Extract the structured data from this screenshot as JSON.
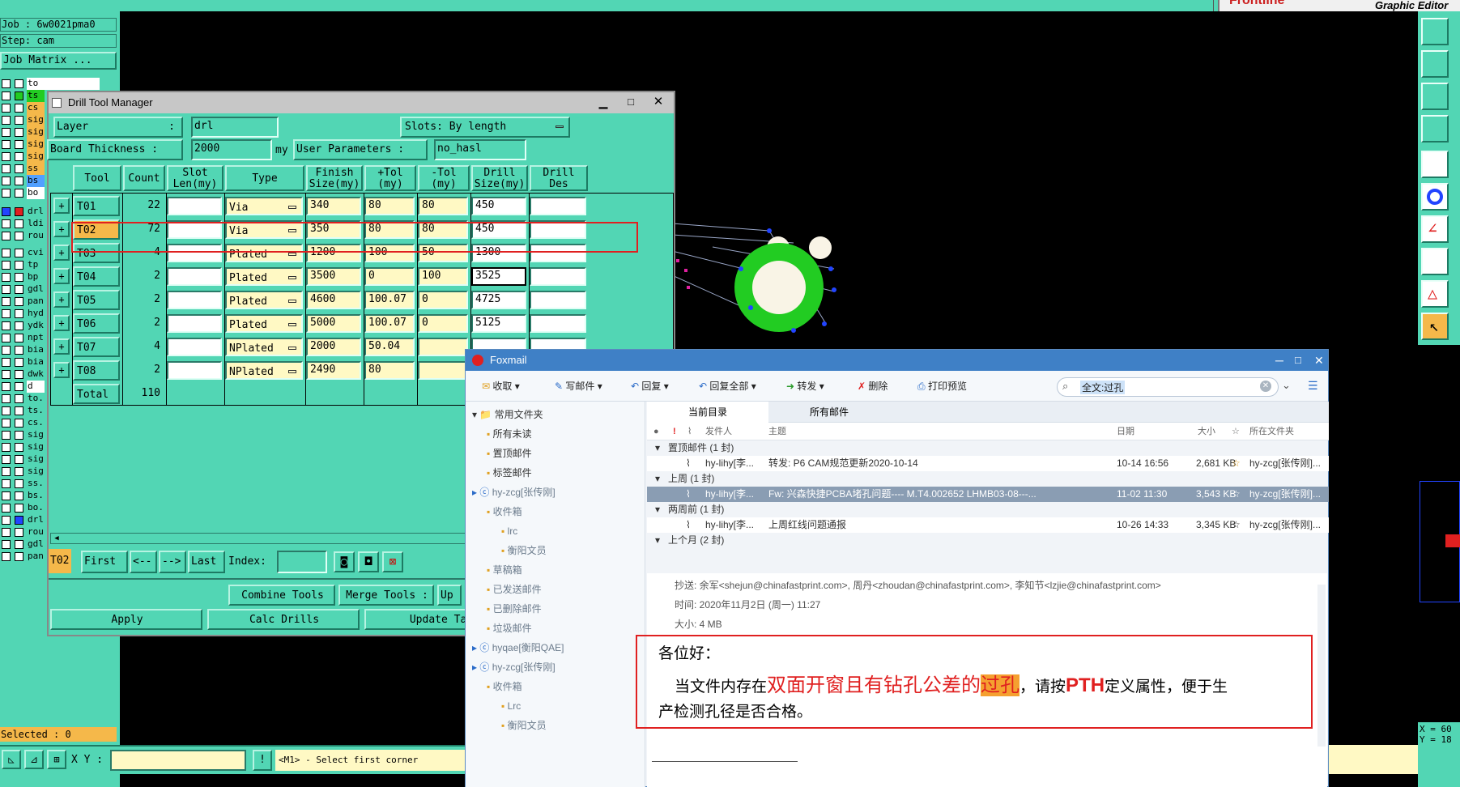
{
  "top": {
    "header_label": "Graphic Editor",
    "logo_label": "Frontline"
  },
  "left_panel": {
    "job_line": "Job : 6w0021pma0",
    "step_line": "Step: cam",
    "job_matrix_label": "Job Matrix ...",
    "layers": [
      "to",
      "ts",
      "cs",
      "sig",
      "sig",
      "sig",
      "sig",
      "ss",
      "bs",
      "bo",
      "drl",
      "ldi",
      "rou",
      "cvi",
      "tp",
      "bp",
      "gdl",
      "pan",
      "hyd",
      "ydk",
      "npt",
      "bia",
      "bia",
      "dwk",
      "d",
      "to.",
      "ts.",
      "cs.",
      "sig",
      "sig",
      "sig",
      "sig",
      "ss.",
      "bs.",
      "bo.",
      "drl",
      "rou",
      "gdl",
      "pan"
    ],
    "selected_label": "Selected : 0"
  },
  "dtm": {
    "title": "Drill Tool Manager",
    "layer_label": "Layer",
    "layer_value": "drl",
    "slots_label": "Slots:",
    "slots_value": "By length",
    "board_thickness_label": "Board Thickness :",
    "board_thickness_value": "2000",
    "board_thickness_unit": "my",
    "user_params_label": "User Parameters :",
    "user_params_value": "no_hasl",
    "headers": {
      "tool": "Tool",
      "count": "Count",
      "slot_len": "Slot Len(my)",
      "type": "Type",
      "finish": "Finish Size(my)",
      "ptol": "+Tol (my)",
      "mtol": "-Tol (my)",
      "drill": "Drill Size(my)",
      "drill_des": "Drill Des"
    },
    "rows": [
      {
        "tool": "T01",
        "count": "22",
        "type": "Via",
        "finish": "340",
        "ptol": "80",
        "mtol": "80",
        "drill": "450"
      },
      {
        "tool": "T02",
        "count": "72",
        "type": "Via",
        "finish": "350",
        "ptol": "80",
        "mtol": "80",
        "drill": "450"
      },
      {
        "tool": "T03",
        "count": "4",
        "type": "Plated",
        "finish": "1200",
        "ptol": "100",
        "mtol": "50",
        "drill": "1300"
      },
      {
        "tool": "T04",
        "count": "2",
        "type": "Plated",
        "finish": "3500",
        "ptol": "0",
        "mtol": "100",
        "drill": "3525"
      },
      {
        "tool": "T05",
        "count": "2",
        "type": "Plated",
        "finish": "4600",
        "ptol": "100.07",
        "mtol": "0",
        "drill": "4725"
      },
      {
        "tool": "T06",
        "count": "2",
        "type": "Plated",
        "finish": "5000",
        "ptol": "100.07",
        "mtol": "0",
        "drill": "5125"
      },
      {
        "tool": "T07",
        "count": "4",
        "type": "NPlated",
        "finish": "2000",
        "ptol": "50.04",
        "mtol": "",
        "drill": ""
      },
      {
        "tool": "T08",
        "count": "2",
        "type": "NPlated",
        "finish": "2490",
        "ptol": "80",
        "mtol": "",
        "drill": ""
      }
    ],
    "total_label": "Total",
    "total_value": "110",
    "nav": {
      "current_tool": "T02",
      "first": "First",
      "prev": "<--",
      "next": "-->",
      "last": "Last",
      "index": "Index:"
    },
    "combine_tools": "Combine Tools",
    "merge_tools": "Merge Tools :",
    "up_label": "Up",
    "apply": "Apply",
    "calc_drills": "Calc Drills",
    "update_tab": "Update Tab"
  },
  "statusbar": {
    "xy_label": "X Y :",
    "hint": "<M1> - Select first corner",
    "coord_x": "X = 60",
    "coord_y": "Y = 18"
  },
  "foxmail": {
    "title": "Foxmail",
    "toolbar": [
      "收取",
      "写邮件",
      "回复",
      "回复全部",
      "转发",
      "删除",
      "打印预览"
    ],
    "search_value": "全文:过孔",
    "folder_tabs": [
      "当前目录",
      "所有邮件"
    ],
    "folders": [
      {
        "label": "常用文件夹",
        "level": 0
      },
      {
        "label": "所有未读",
        "level": 1
      },
      {
        "label": "置顶邮件",
        "level": 1
      },
      {
        "label": "标签邮件",
        "level": 1
      },
      {
        "label": "hy-zcg[张传刚]",
        "level": 0
      },
      {
        "label": "收件箱",
        "level": 1
      },
      {
        "label": "lrc",
        "level": 2
      },
      {
        "label": "衡阳文员",
        "level": 2
      },
      {
        "label": "草稿箱",
        "level": 1
      },
      {
        "label": "已发送邮件",
        "level": 1
      },
      {
        "label": "已删除邮件",
        "level": 1
      },
      {
        "label": "垃圾邮件",
        "level": 1
      },
      {
        "label": "hyqae[衡阳QAE]",
        "level": 0
      },
      {
        "label": "hy-zcg[张传刚]",
        "level": 0
      },
      {
        "label": "收件箱",
        "level": 1
      },
      {
        "label": "Lrc",
        "level": 2
      },
      {
        "label": "衡阳文员",
        "level": 2
      }
    ],
    "columns": {
      "sender": "发件人",
      "subject": "主题",
      "date": "日期",
      "size": "大小",
      "folder": "所在文件夹"
    },
    "groups": [
      {
        "label": "置顶邮件 (1 封)"
      },
      {
        "label": "上周 (1 封)"
      },
      {
        "label": "两周前 (1 封)"
      },
      {
        "label": "上个月 (2 封)"
      }
    ],
    "mails": [
      {
        "sender": "hy-lihy[李...",
        "subject": "转发: P6 CAM规范更新2020-10-14",
        "date": "10-14 16:56",
        "size": "2,681 KB",
        "folder": "hy-zcg[张传刚]..."
      },
      {
        "sender": "hy-lihy[李...",
        "subject": "Fw: 兴森快捷PCBA堵孔问题----  M.T4.002652 LHMB03-08---...",
        "date": "11-02 11:30",
        "size": "3,543 KB",
        "folder": "hy-zcg[张传刚]..."
      },
      {
        "sender": "hy-lihy[李...",
        "subject": "上周红线问题通报",
        "date": "10-26 14:33",
        "size": "3,345 KB",
        "folder": "hy-zcg[张传刚]..."
      }
    ],
    "preview": {
      "cc": "抄送: 余军<shejun@chinafastprint.com>, 周丹<zhoudan@chinafastprint.com>, 李知节<lzjie@chinafastprint.com>",
      "time": "时间: 2020年11月2日 (周一) 11:27",
      "size": "大小: 4 MB",
      "greeting": "各位好：",
      "body_a": "当文件内存在",
      "body_b": "双面开窗且有钻孔公差的",
      "body_c": "过孔",
      "body_d": "，请按",
      "body_e": "PTH",
      "body_f": "定义属性，便于生",
      "body_g": "产检测孔径是否合格。"
    }
  },
  "colors": {
    "teal": "#52d6b4",
    "yellow": "#fff9c4",
    "highlight_red": "#e02020"
  }
}
